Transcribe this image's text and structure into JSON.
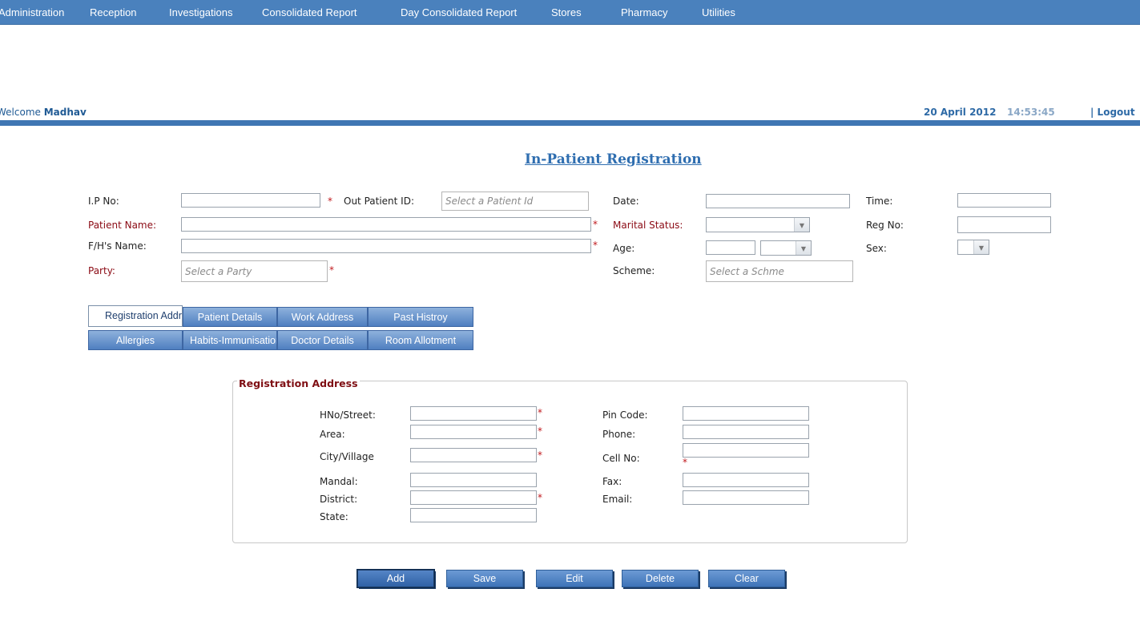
{
  "menu": [
    "Administration",
    "Reception",
    "Investigations",
    "Consolidated Report",
    "Day Consolidated Report",
    "Stores",
    "Pharmacy",
    "Utilities"
  ],
  "header": {
    "welcome_prefix": "Welcome",
    "user": "Madhav",
    "date": "20 April 2012",
    "time": "14:53:45",
    "logout": "| Logout"
  },
  "title": "In-Patient Registration",
  "form": {
    "ip_no": "I.P No:",
    "out_patient_id": "Out Patient ID:",
    "out_patient_placeholder": "Select a Patient Id",
    "date": "Date:",
    "time": "Time:",
    "patient_name": "Patient Name:",
    "marital_status": "Marital Status:",
    "reg_no": "Reg No:",
    "fh_name": "F/H's Name:",
    "age": "Age:",
    "sex": "Sex:",
    "party": "Party:",
    "party_placeholder": "Select a Party",
    "scheme": "Scheme:",
    "scheme_placeholder": "Select a Schme",
    "required_mark": "*"
  },
  "tabs": {
    "row1": [
      "Registration Address",
      "Patient Details",
      "Work Address",
      "Past Histroy"
    ],
    "row2": [
      "Allergies",
      "Habits-Immunisation",
      "Doctor Details",
      "Room Allotment"
    ]
  },
  "address": {
    "legend": "Registration Address",
    "hno_street": "HNo/Street:",
    "area": "Area:",
    "city_village": "City/Village",
    "mandal": "Mandal:",
    "district": "District:",
    "state": "State:",
    "pin_code": "Pin Code:",
    "phone": "Phone:",
    "cell_no": "Cell No:",
    "fax": "Fax:",
    "email": "Email:"
  },
  "buttons": [
    "Add",
    "Save",
    "Edit",
    "Delete",
    "Clear"
  ]
}
